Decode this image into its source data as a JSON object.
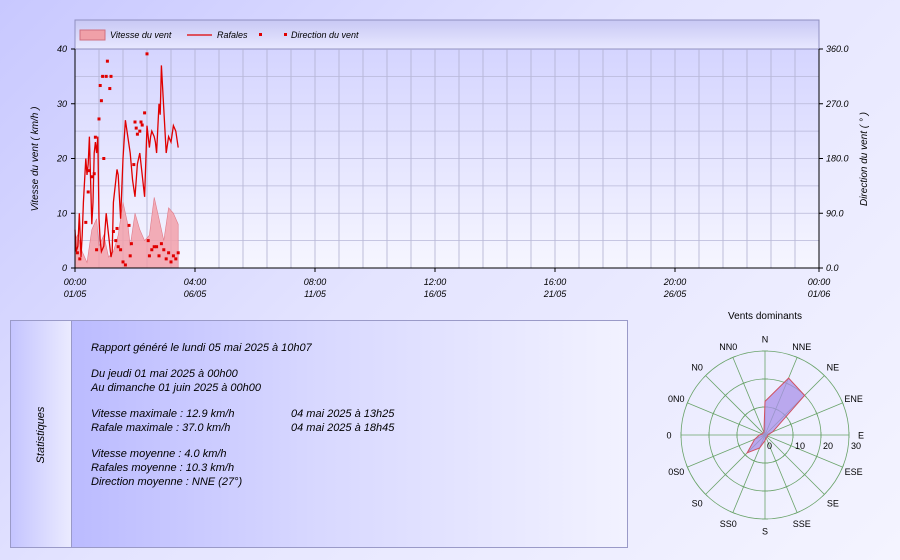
{
  "colors": {
    "accent": "#e00000",
    "speed_fill": "#f4a8b0",
    "rose_fill": "#a890e8",
    "rose_stroke": "#d05060",
    "rose_grid": "#6aa36a"
  },
  "chart_data": [
    {
      "type": "area",
      "legend": [
        "Vitesse du vent",
        "Rafales",
        "Direction du vent"
      ],
      "ylabel": "Vitesse du vent ( km/h )",
      "y2label": "Direction du vent ( ° )",
      "ylim": [
        0,
        40
      ],
      "y2lim": [
        0,
        360
      ],
      "yticks": [
        "0",
        "10",
        "20",
        "30",
        "40"
      ],
      "y2ticks": [
        "0.0",
        "90.0",
        "180.0",
        "270.0",
        "360.0"
      ],
      "xlim": [
        0,
        31
      ],
      "xticks": [
        {
          "value": 0,
          "time": "00:00",
          "date": "01/05"
        },
        {
          "value": 5,
          "time": "04:00",
          "date": "06/05"
        },
        {
          "value": 10,
          "time": "08:00",
          "date": "11/05"
        },
        {
          "value": 15,
          "time": "12:00",
          "date": "16/05"
        },
        {
          "value": 20,
          "time": "16:00",
          "date": "21/05"
        },
        {
          "value": 25,
          "time": "20:00",
          "date": "26/05"
        },
        {
          "value": 31,
          "time": "00:00",
          "date": "01/06"
        }
      ],
      "grid": true,
      "legend_position": "top-left",
      "series": [
        {
          "name": "Vitesse du vent",
          "type": "area",
          "x": [
            0,
            0.1,
            0.3,
            0.5,
            0.7,
            0.9,
            1.0,
            1.2,
            1.4,
            1.6,
            1.8,
            2.0,
            2.2,
            2.3,
            2.5,
            2.7,
            2.9,
            3.1,
            3.3,
            3.5,
            3.7,
            3.9,
            4.1,
            4.3
          ],
          "values": [
            5,
            6,
            3,
            1,
            7,
            9,
            4,
            6,
            2,
            3,
            6,
            12,
            8,
            4,
            10,
            7,
            5,
            6,
            12.9,
            9,
            5,
            11,
            10,
            8
          ]
        },
        {
          "name": "Rafales",
          "type": "line",
          "x": [
            0,
            0.05,
            0.12,
            0.18,
            0.25,
            0.3,
            0.35,
            0.45,
            0.5,
            0.55,
            0.6,
            0.7,
            0.75,
            0.8,
            0.85,
            0.9,
            0.95,
            1.0,
            1.05,
            1.1,
            1.2,
            1.3,
            1.4,
            1.5,
            1.55,
            1.6,
            1.7,
            1.75,
            1.8,
            1.9,
            2.0,
            2.1,
            2.2,
            2.3,
            2.4,
            2.5,
            2.6,
            2.7,
            2.8,
            2.9,
            3.0,
            3.1,
            3.15,
            3.2,
            3.3,
            3.35,
            3.4,
            3.5,
            3.55,
            3.6,
            3.7,
            3.8,
            3.9,
            4.0,
            4.1,
            4.2,
            4.3
          ],
          "values": [
            7,
            3,
            4,
            10,
            2,
            6,
            12,
            20,
            17,
            19,
            24,
            8,
            12,
            21,
            23,
            21,
            24,
            9,
            5,
            3,
            4,
            10,
            6,
            2,
            3,
            12,
            16,
            18,
            17,
            9,
            20,
            27,
            24,
            21,
            16,
            13,
            19,
            21,
            17,
            13,
            26,
            22,
            24,
            25,
            24,
            23,
            21,
            30,
            28,
            37,
            29,
            21,
            24,
            23,
            26,
            25,
            22
          ]
        },
        {
          "name": "Direction du vent",
          "type": "scatter",
          "axis": "right",
          "x": [
            0.1,
            0.2,
            0.45,
            0.55,
            0.6,
            0.7,
            0.8,
            0.85,
            0.9,
            1.0,
            1.05,
            1.1,
            1.15,
            1.2,
            1.3,
            1.35,
            1.45,
            1.5,
            1.6,
            1.7,
            1.75,
            1.8,
            1.9,
            2.0,
            2.1,
            2.25,
            2.3,
            2.35,
            2.45,
            2.5,
            2.55,
            2.6,
            2.7,
            2.75,
            2.8,
            2.9,
            3.0,
            3.05,
            3.1,
            3.2,
            3.3,
            3.4,
            3.5,
            3.6,
            3.7,
            3.8,
            3.9,
            4.0,
            4.1,
            4.2,
            4.3
          ],
          "values": [
            25,
            15,
            75,
            125,
            160,
            150,
            155,
            215,
            30,
            245,
            300,
            275,
            315,
            180,
            315,
            340,
            295,
            315,
            60,
            45,
            65,
            35,
            30,
            10,
            5,
            70,
            20,
            40,
            170,
            240,
            230,
            220,
            225,
            240,
            235,
            255,
            352,
            45,
            20,
            30,
            35,
            35,
            20,
            40,
            30,
            15,
            25,
            10,
            20,
            15,
            25
          ]
        }
      ]
    },
    {
      "type": "radar",
      "title": "Vents dominants",
      "directions": [
        "N",
        "NNE",
        "NE",
        "ENE",
        "E",
        "ESE",
        "SE",
        "SSE",
        "S",
        "SS0",
        "S0",
        "0S0",
        "0",
        "0N0",
        "N0",
        "NN0"
      ],
      "radial_ticks": [
        "0",
        "10",
        "20",
        "30"
      ],
      "rmax": 30,
      "series": [
        {
          "name": "Vents dominants",
          "values": [
            12,
            22,
            20,
            3,
            1,
            1,
            1,
            1,
            2,
            5,
            9,
            4,
            2,
            1,
            1,
            1
          ]
        }
      ]
    }
  ],
  "statistics": {
    "title": "Statistiques",
    "generated": "Rapport généré le lundi 05 mai 2025 à 10h07",
    "from": "Du jeudi 01 mai 2025 à 00h00",
    "to": "Au dimanche 01 juin 2025 à 00h00",
    "max_speed_label": "Vitesse maximale : 12.9 km/h",
    "max_speed_date": "04 mai 2025 à 13h25",
    "max_gust_label": "Rafale maximale : 37.0 km/h",
    "max_gust_date": "04 mai 2025 à 18h45",
    "avg_speed": "Vitesse moyenne : 4.0 km/h",
    "avg_gust": "Rafales moyenne : 10.3 km/h",
    "avg_direction": "Direction moyenne : NNE (27°)"
  }
}
